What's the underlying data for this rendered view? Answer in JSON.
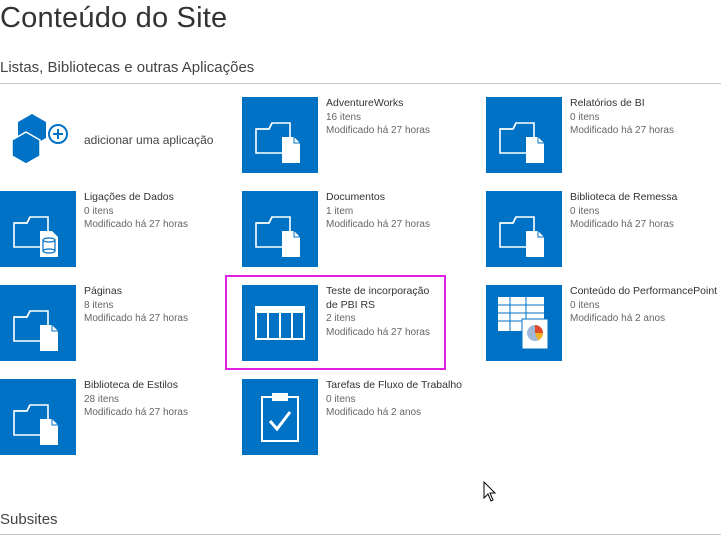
{
  "page": {
    "title": "Conteúdo do Site",
    "lists_heading": "Listas, Bibliotecas e outras Aplicações",
    "subsites_heading": "Subsites"
  },
  "add_app": {
    "label": "adicionar uma aplicação",
    "icon": "add-app-icon"
  },
  "tiles": [
    {
      "name": "AdventureWorks",
      "count": "16 itens",
      "modified": "Modificado há 27 horas",
      "icon": "folder-document-icon"
    },
    {
      "name": "Relatórios de BI",
      "count": "0 itens",
      "modified": "Modificado há 27 horas",
      "icon": "folder-document-icon"
    },
    {
      "name": "Ligações de Dados",
      "count": "0 itens",
      "modified": "Modificado há 27 horas",
      "icon": "folder-database-icon"
    },
    {
      "name": "Documentos",
      "count": "1 item",
      "modified": "Modificado há 27 horas",
      "icon": "folder-document-icon"
    },
    {
      "name": "Biblioteca de Remessa",
      "count": "0 itens",
      "modified": "Modificado há 27 horas",
      "icon": "folder-document-icon"
    },
    {
      "name": "Páginas",
      "count": "8 itens",
      "modified": "Modificado há 27 horas",
      "icon": "folder-document-icon"
    },
    {
      "name_line1": "Teste de incorporação",
      "name_line2": "de PBI RS",
      "count": "2 itens",
      "modified": "Modificado há 27 horas",
      "icon": "table-icon"
    },
    {
      "name": "Conteúdo do PerformancePoint",
      "count": "0 itens",
      "modified": "Modificado há 2 anos",
      "icon": "performancepoint-icon"
    },
    {
      "name": "Biblioteca de Estilos",
      "count": "28 itens",
      "modified": "Modificado há 27 horas",
      "icon": "folder-document-icon"
    },
    {
      "name": "Tarefas de Fluxo de Trabalho",
      "count": "0 itens",
      "modified": "Modificado há 2 anos",
      "icon": "clipboard-check-icon"
    }
  ],
  "colors": {
    "tile": "#0072c6",
    "highlight": "#e020e0"
  }
}
